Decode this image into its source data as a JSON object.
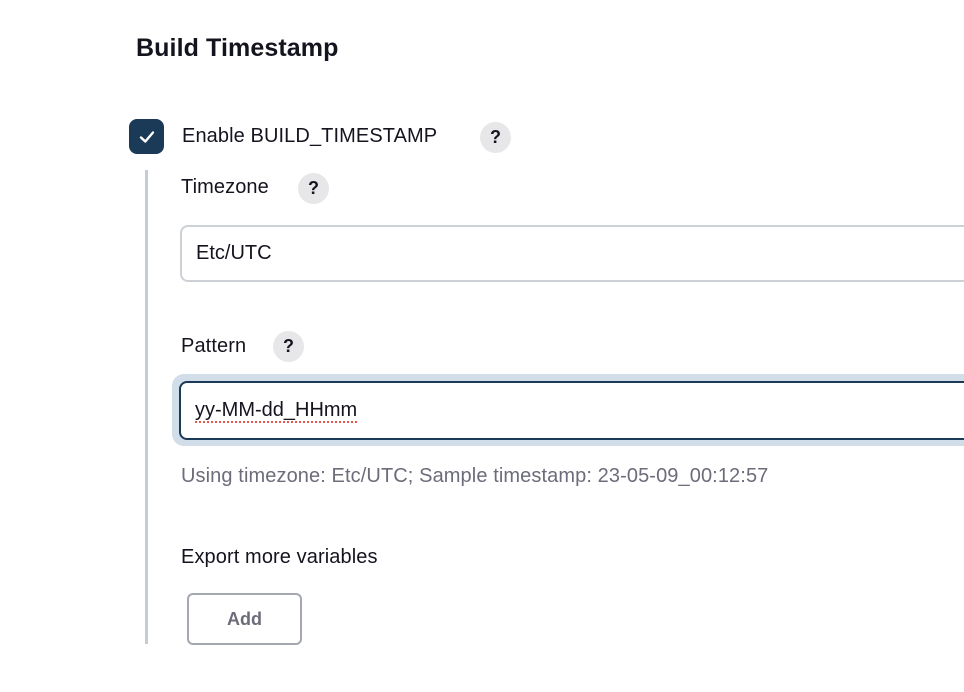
{
  "section": {
    "title": "Build Timestamp"
  },
  "enable": {
    "label": "Enable BUILD_TIMESTAMP",
    "checked": true,
    "help": "?"
  },
  "timezone": {
    "label": "Timezone",
    "help": "?",
    "value": "Etc/UTC"
  },
  "pattern": {
    "label": "Pattern",
    "help": "?",
    "value": "yy-MM-dd_HHmm",
    "hint": "Using timezone: Etc/UTC; Sample timestamp: 23-05-09_00:12:57"
  },
  "export": {
    "label": "Export more variables",
    "add_button": "Add"
  },
  "icons": {
    "checkbox": "check-icon",
    "help": "question-mark-icon"
  },
  "colors": {
    "accent": "#1b3a57",
    "focus_ring": "#d1dde9",
    "help_bg": "#e7e7ea",
    "hint_text": "#6c6c7a",
    "spellcheck": "#e5584c"
  }
}
